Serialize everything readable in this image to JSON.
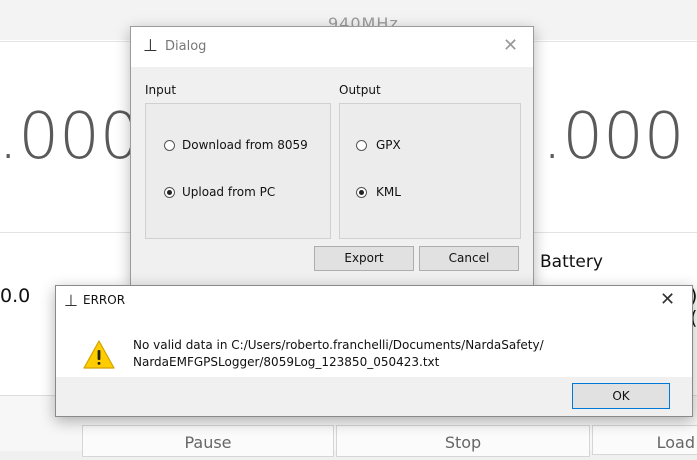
{
  "background": {
    "frequency": "940MHz",
    "big_left": ".000",
    "big_right": ".000",
    "battery_label": "Battery",
    "zero_left": "0.0",
    "zero_right": ")(",
    "buttons": {
      "pause": "Pause",
      "stop": "Stop",
      "load": "Load"
    }
  },
  "dialog": {
    "title": "Dialog",
    "input": {
      "label": "Input",
      "options": [
        {
          "label": "Download from 8059",
          "checked": false
        },
        {
          "label": "Upload from PC",
          "checked": true
        }
      ]
    },
    "output": {
      "label": "Output",
      "options": [
        {
          "label": "GPX",
          "checked": false
        },
        {
          "label": "KML",
          "checked": true
        }
      ]
    },
    "export_label": "Export",
    "cancel_label": "Cancel"
  },
  "error": {
    "title": "ERROR",
    "message_line1": "No valid data in C:/Users/roberto.franchelli/Documents/NardaSafety/",
    "message_line2": "NardaEMFGPSLogger/8059Log_123850_050423.txt",
    "ok_label": "OK",
    "close_glyph": "✕"
  },
  "colors": {
    "accent": "#0078d7",
    "warning": "#ffcc00"
  }
}
